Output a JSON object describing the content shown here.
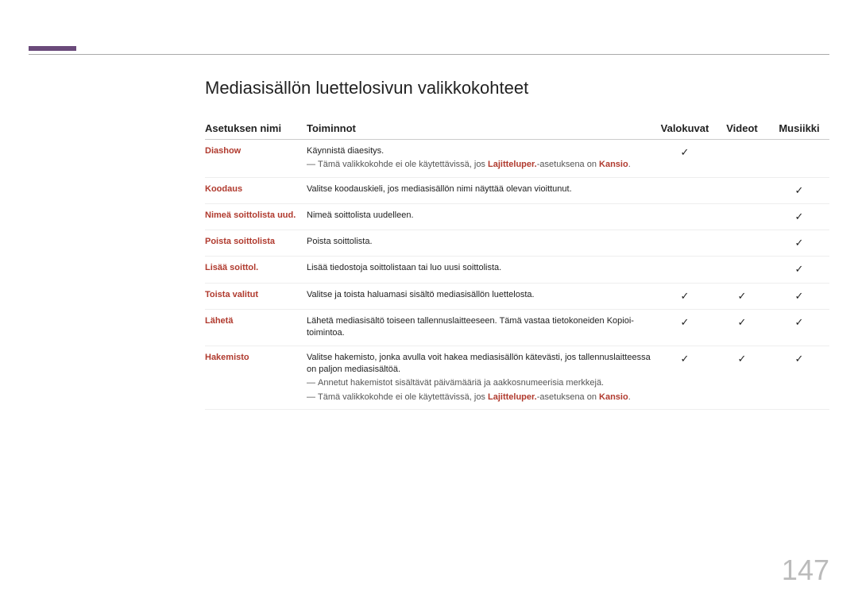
{
  "title": "Mediasisällön luettelosivun valikkokohteet",
  "headers": {
    "name": "Asetuksen nimi",
    "functions": "Toiminnot",
    "photos": "Valokuvat",
    "videos": "Videot",
    "music": "Musiikki"
  },
  "rows": [
    {
      "name": "Diashow",
      "main": "Käynnistä diaesitys.",
      "note_pre": "Tämä valikkokohde ei ole käytettävissä, jos ",
      "note_hl1": "Lajitteluper.",
      "note_mid": "-asetuksena on ",
      "note_hl2": "Kansio",
      "note_post": ".",
      "photos": true,
      "videos": false,
      "music": false
    },
    {
      "name": "Koodaus",
      "main": "Valitse koodauskieli, jos mediasisällön nimi näyttää olevan vioittunut.",
      "photos": false,
      "videos": false,
      "music": true
    },
    {
      "name": "Nimeä soittolista uud.",
      "main": "Nimeä soittolista uudelleen.",
      "photos": false,
      "videos": false,
      "music": true
    },
    {
      "name": "Poista soittolista",
      "main": "Poista soittolista.",
      "photos": false,
      "videos": false,
      "music": true
    },
    {
      "name": "Lisää soittol.",
      "main": "Lisää tiedostoja soittolistaan tai luo uusi soittolista.",
      "photos": false,
      "videos": false,
      "music": true
    },
    {
      "name": "Toista valitut",
      "main": "Valitse ja toista haluamasi sisältö mediasisällön luettelosta.",
      "photos": true,
      "videos": true,
      "music": true
    },
    {
      "name": "Lähetä",
      "main": "Lähetä mediasisältö toiseen tallennuslaitteeseen. Tämä vastaa tietokoneiden Kopioi-toimintoa.",
      "photos": true,
      "videos": true,
      "music": true
    },
    {
      "name": "Hakemisto",
      "main": "Valitse hakemisto, jonka avulla voit hakea mediasisällön kätevästi, jos tallennuslaitteessa on paljon mediasisältöä.",
      "note_simple": "Annetut hakemistot sisältävät päivämääriä ja aakkosnumeerisia merkkejä.",
      "note_pre": "Tämä valikkokohde ei ole käytettävissä, jos ",
      "note_hl1": "Lajitteluper.",
      "note_mid": "-asetuksena on ",
      "note_hl2": "Kansio",
      "note_post": ".",
      "photos": true,
      "videos": true,
      "music": true
    }
  ],
  "check": "c",
  "page_number": "147"
}
